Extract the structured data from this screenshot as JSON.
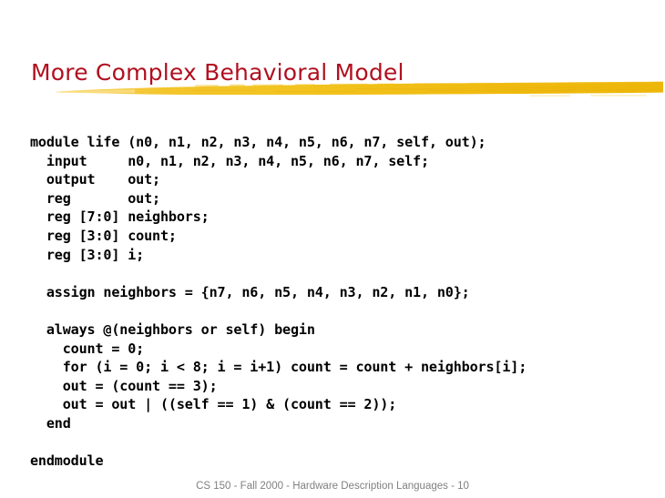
{
  "slide": {
    "title": "More Complex Behavioral Model",
    "title_color": "#b0101f",
    "background_color": "#ffffff",
    "divider": {
      "name": "yellow-brush-stroke",
      "color": "#f3c317",
      "color_light": "#f7d44e",
      "color_dark": "#e8a90a"
    },
    "code": {
      "language": "verilog",
      "lines": [
        "module life (n0, n1, n2, n3, n4, n5, n6, n7, self, out);",
        "  input     n0, n1, n2, n3, n4, n5, n6, n7, self;",
        "  output    out;",
        "  reg       out;",
        "  reg [7:0] neighbors;",
        "  reg [3:0] count;",
        "  reg [3:0] i;",
        "",
        "  assign neighbors = {n7, n6, n5, n4, n3, n2, n1, n0};",
        "",
        "  always @(neighbors or self) begin",
        "    count = 0;",
        "    for (i = 0; i < 8; i = i+1) count = count + neighbors[i];",
        "    out = (count == 3);",
        "    out = out | ((self == 1) & (count == 2));",
        "  end",
        "",
        "endmodule"
      ]
    },
    "footer": "CS 150 - Fall 2000 - Hardware Description Languages - 10"
  }
}
